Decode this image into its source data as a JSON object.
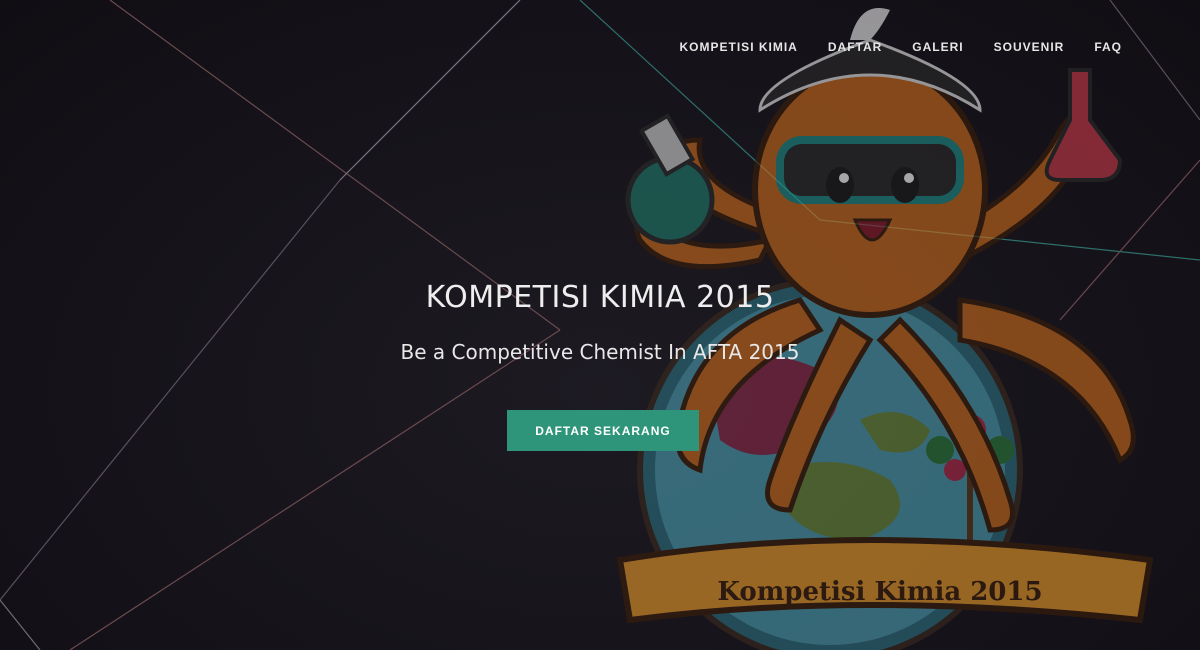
{
  "nav": {
    "items": [
      {
        "label": "KOMPETISI KIMIA"
      },
      {
        "label": "DAFTAR"
      },
      {
        "label": "GALERI"
      },
      {
        "label": "SOUVENIR"
      },
      {
        "label": "FAQ"
      }
    ]
  },
  "hero": {
    "title": "KOMPETISI KIMIA 2015",
    "subtitle": "Be a Competitive Chemist In AFTA 2015",
    "cta_label": "DAFTAR SEKARANG"
  },
  "mascot": {
    "banner_text": "Kompetisi Kimia 2015"
  },
  "colors": {
    "background": "#17141b",
    "accent": "#2e957a",
    "octopus": "#c86a1c"
  }
}
